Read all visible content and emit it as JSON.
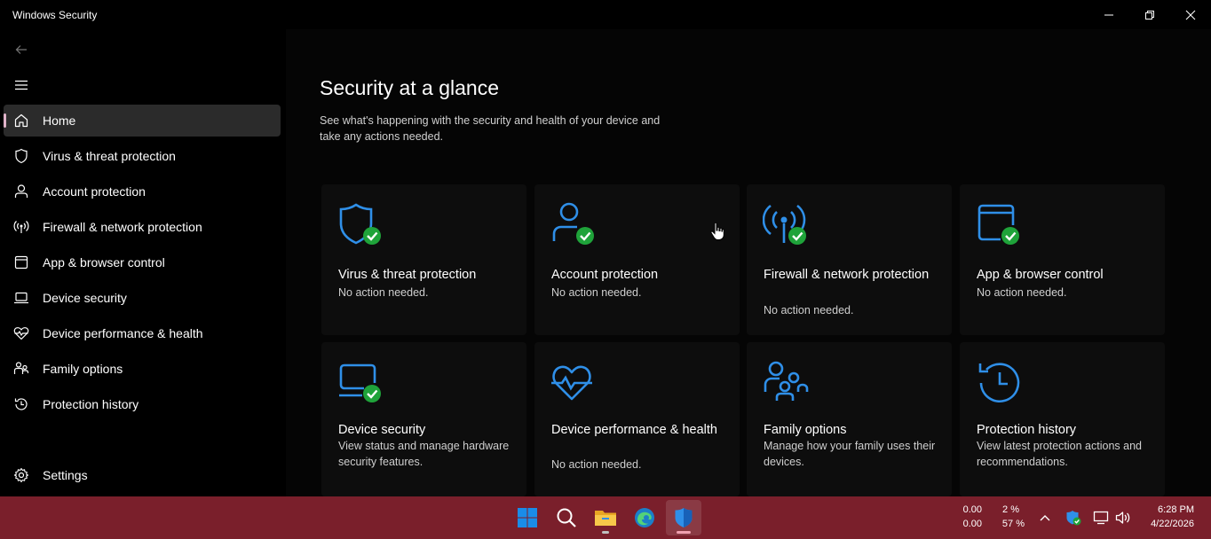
{
  "window": {
    "title": "Windows Security",
    "minimize_label": "minimize",
    "restore_label": "restore",
    "close_label": "close"
  },
  "sidebar": {
    "items": [
      {
        "label": "Home",
        "icon": "home-icon",
        "active": true
      },
      {
        "label": "Virus & threat protection",
        "icon": "shield-icon"
      },
      {
        "label": "Account protection",
        "icon": "person-icon"
      },
      {
        "label": "Firewall & network protection",
        "icon": "antenna-icon"
      },
      {
        "label": "App & browser control",
        "icon": "browser-window-icon"
      },
      {
        "label": "Device security",
        "icon": "laptop-icon"
      },
      {
        "label": "Device performance & health",
        "icon": "heart-pulse-icon"
      },
      {
        "label": "Family options",
        "icon": "family-icon"
      },
      {
        "label": "Protection history",
        "icon": "history-icon"
      }
    ],
    "settings_label": "Settings"
  },
  "main": {
    "title": "Security at a glance",
    "subtitle": "See what's happening with the security and health of your device and take any actions needed.",
    "cards": [
      {
        "title": "Virus & threat protection",
        "desc": "No action needed.",
        "icon": "shield-icon",
        "status": "ok"
      },
      {
        "title": "Account protection",
        "desc": "No action needed.",
        "icon": "person-icon",
        "status": "ok"
      },
      {
        "title": "Firewall & network protection",
        "desc": "No action needed.",
        "icon": "antenna-icon",
        "status": "ok"
      },
      {
        "title": "App & browser control",
        "desc": "No action needed.",
        "icon": "browser-window-icon",
        "status": "ok"
      },
      {
        "title": "Device security",
        "desc": "View status and manage hardware security features.",
        "icon": "laptop-icon",
        "status": "ok"
      },
      {
        "title": "Device performance & health",
        "desc": "No action needed.",
        "icon": "heart-pulse-icon"
      },
      {
        "title": "Family options",
        "desc": "Manage how your family uses their devices.",
        "icon": "family-icon"
      },
      {
        "title": "Protection history",
        "desc": "View latest protection actions and recommendations.",
        "icon": "history-icon"
      }
    ]
  },
  "taskbar": {
    "apps": [
      "start-icon",
      "search-icon",
      "file-explorer-icon",
      "edge-icon",
      "windows-security-icon"
    ],
    "net_up": "0.00",
    "net_down": "0.00",
    "cpu": "2 %",
    "mem": "57 %",
    "time": "6:28 PM",
    "date": "4/22/2026"
  },
  "colors": {
    "accent_blue": "#2f8fe8",
    "ok_green": "#1fa33a",
    "taskbar": "#7a1f2b",
    "nav_indicator": "#e0b3c9"
  }
}
